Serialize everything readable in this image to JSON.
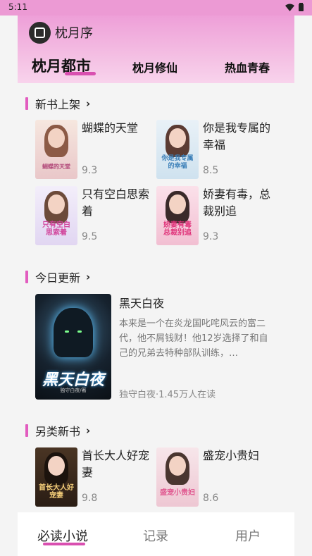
{
  "status": {
    "time": "5:11"
  },
  "header": {
    "app_name": "枕月序",
    "tabs": [
      "枕月都市",
      "枕月修仙",
      "热血青春"
    ]
  },
  "sections": {
    "new_books": {
      "title": "新书上架",
      "books": [
        {
          "name": "蝴蝶的天堂",
          "score": "9.3",
          "cover_text": "蝴蝶的天堂"
        },
        {
          "name": "你是我专属的幸福",
          "score": "8.5",
          "cover_text": "你是我专属的幸福"
        },
        {
          "name": "只有空白思索着",
          "score": "9.5",
          "cover_text": "只有空白思索着"
        },
        {
          "name": "娇妻有毒，总裁别追",
          "score": "9.3",
          "cover_text": "娇妻有毒总裁别追"
        }
      ]
    },
    "today_update": {
      "title": "今日更新",
      "featured": {
        "name": "黑天白夜",
        "cover_title": "黑天白夜",
        "cover_author": "独守白夜/著",
        "description": "本来是一个在炎龙国叱咤风云的富二代，他不屑钱财！他12岁选择了和自己的兄弟去特种部队训练，…",
        "meta": "独守白夜·1.45万人在读"
      }
    },
    "other_new": {
      "title": "另类新书",
      "books": [
        {
          "name": "首长大人好宠妻",
          "score": "9.8",
          "cover_text": "首长大人好宠妻"
        },
        {
          "name": "盛宠小贵妇",
          "score": "8.6",
          "cover_text": "盛宠小贵妇"
        }
      ]
    }
  },
  "bottom_nav": [
    "必读小说",
    "记录",
    "用户"
  ],
  "colors": {
    "accent": "#d94fb0",
    "header": "#ee9fd8"
  }
}
